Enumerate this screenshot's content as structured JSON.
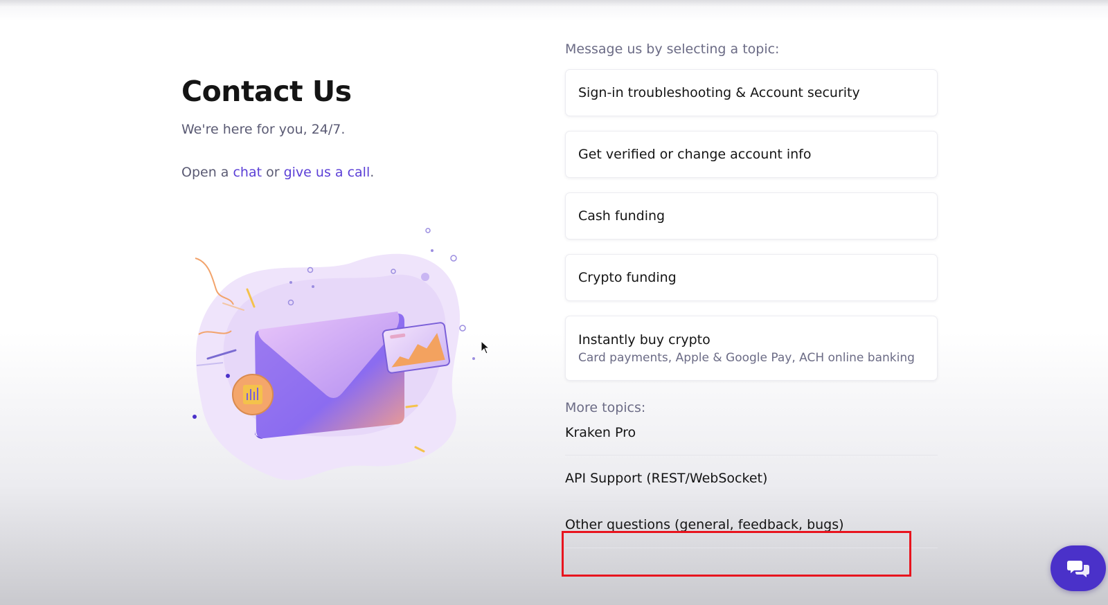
{
  "left": {
    "title": "Contact Us",
    "subtitle": "We're here for you, 24/7.",
    "contact_prefix": "Open a ",
    "chat_link": "chat",
    "contact_middle": " or ",
    "call_link": "give us a call",
    "contact_suffix": "."
  },
  "topics": {
    "label": "Message us by selecting a topic:",
    "items": [
      {
        "title": "Sign-in troubleshooting & Account security"
      },
      {
        "title": "Get verified or change account info"
      },
      {
        "title": "Cash funding"
      },
      {
        "title": "Crypto funding"
      },
      {
        "title": "Instantly buy crypto",
        "subtitle": "Card payments, Apple & Google Pay, ACH online banking"
      }
    ]
  },
  "more": {
    "label": "More topics:",
    "items": [
      {
        "label": "Kraken Pro"
      },
      {
        "label": "API Support (REST/WebSocket)"
      },
      {
        "label": "Other questions (general, feedback, bugs)"
      }
    ]
  },
  "colors": {
    "accent": "#5b3fd6",
    "fab": "#4a31c9",
    "highlight": "#e8141e"
  },
  "icons": {
    "chat_fab": "chat-bubbles-icon",
    "illustration": "envelope-illustration",
    "cursor": "mouse-cursor-icon"
  }
}
